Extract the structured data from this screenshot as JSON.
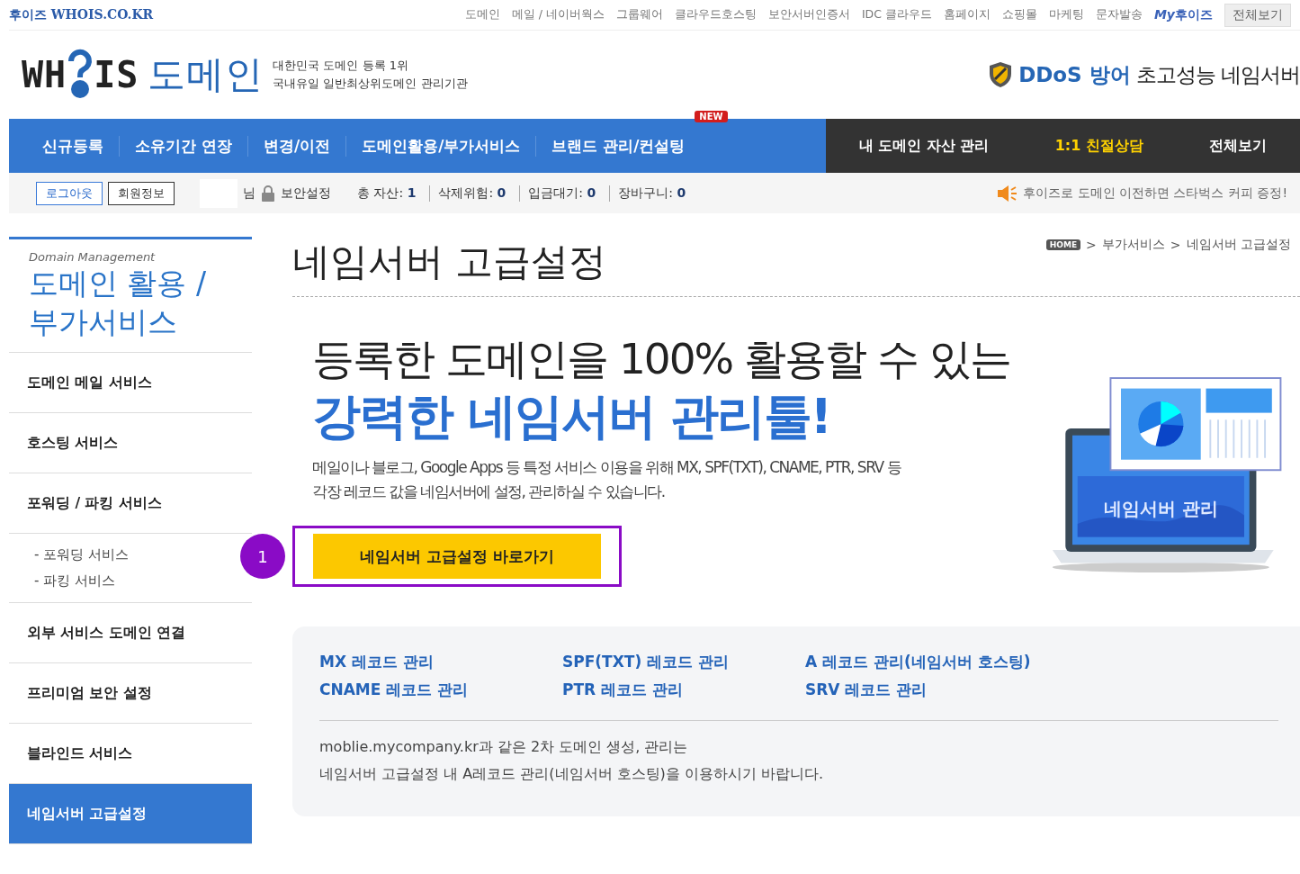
{
  "top_bar": {
    "brand": "후이즈 WHOIS.CO.KR",
    "links": [
      "도메인",
      "메일 / 네이버웍스",
      "그룹웨어",
      "클라우드호스팅",
      "보안서버인증서",
      "IDC 클라우드",
      "홈페이지",
      "쇼핑몰",
      "마케팅",
      "문자발송"
    ],
    "my_prefix": "My",
    "my_label": "후이즈",
    "all_button": "전체보기"
  },
  "header": {
    "logo_text": "WH",
    "logo_text_end": "IS",
    "logo_domain": "도메인",
    "tagline": [
      "대한민국 도메인 등록 1위",
      "국내유일 일반최상위도메인 관리기관"
    ],
    "promo_strong": "DDoS 방어",
    "promo_rest": "초고성능 네임서버"
  },
  "nav": {
    "main": [
      {
        "label": "신규등록"
      },
      {
        "label": "소유기간 연장"
      },
      {
        "label": "변경/이전"
      },
      {
        "label": "도메인활용/부가서비스"
      },
      {
        "label": "브랜드 관리/컨설팅",
        "badge": "NEW"
      }
    ],
    "side": [
      {
        "label": "내 도메인 자산 관리",
        "highlight": false
      },
      {
        "label": "1:1 친절상담",
        "highlight": true
      },
      {
        "label": "전체보기",
        "highlight": false
      }
    ]
  },
  "info_bar": {
    "buttons": [
      {
        "label": "로그아웃",
        "kind": "primary"
      },
      {
        "label": "회원정보",
        "kind": "plain"
      }
    ],
    "suffix": "님",
    "security": "보안설정",
    "stats": [
      {
        "label": "총 자산:",
        "value": "1"
      },
      {
        "label": "삭제위험:",
        "value": "0"
      },
      {
        "label": "입금대기:",
        "value": "0"
      },
      {
        "label": "장바구니:",
        "value": "0"
      }
    ],
    "notice": "후이즈로 도메인 이전하면 스타벅스 커피 증정!"
  },
  "sidebar": {
    "caption": "Domain Management",
    "title": "도메인 활용 / 부가서비스",
    "items": [
      {
        "label": "도메인 메일 서비스",
        "selected": false
      },
      {
        "label": "호스팅 서비스",
        "selected": false
      },
      {
        "label": "포워딩 / 파킹 서비스",
        "selected": false,
        "children": [
          {
            "label": "- 포워딩 서비스"
          },
          {
            "label": "- 파킹 서비스"
          }
        ]
      },
      {
        "label": "외부 서비스 도메인 연결",
        "selected": false
      },
      {
        "label": "프리미엄 보안 설정",
        "selected": false
      },
      {
        "label": "블라인드 서비스",
        "selected": false
      },
      {
        "label": "네임서버 고급설정",
        "selected": true
      }
    ]
  },
  "page": {
    "title": "네임서버 고급설정",
    "breadcrumb": [
      {
        "label": "HOME",
        "kind": "home"
      },
      {
        "label": ">",
        "kind": "separator"
      },
      {
        "label": "부가서비스",
        "kind": "link"
      },
      {
        "label": ">",
        "kind": "separator"
      },
      {
        "label": "네임서버 고급설정",
        "kind": "link"
      }
    ]
  },
  "hero": {
    "line1": "등록한 도메인을 100% 활용할 수 있는",
    "line2": "강력한 네임서버 관리툴!",
    "description": [
      "메일이나 블로그, Google Apps 등 특정 서비스 이용을 위해 MX, SPF(TXT), CNAME, PTR, SRV 등",
      "각장 레코드 값을 네임서버에 설정, 관리하실 수 있습니다."
    ],
    "cta": "네임서버 고급설정 바로가기",
    "step": "1",
    "illustration_label": "네임서버 관리"
  },
  "records": {
    "links": [
      "MX 레코드 관리",
      "SPF(TXT) 레코드 관리",
      "A 레코드 관리(네임서버 호스팅)",
      "CNAME 레코드 관리",
      "PTR 레코드 관리",
      "SRV 레코드 관리"
    ],
    "note": [
      "moblie.mycompany.kr과 같은 2차 도메인 생성, 관리는",
      "네임서버 고급설정 내 A레코드 관리(네임서버 호스팅)을 이용하시기 바랍니다."
    ]
  }
}
